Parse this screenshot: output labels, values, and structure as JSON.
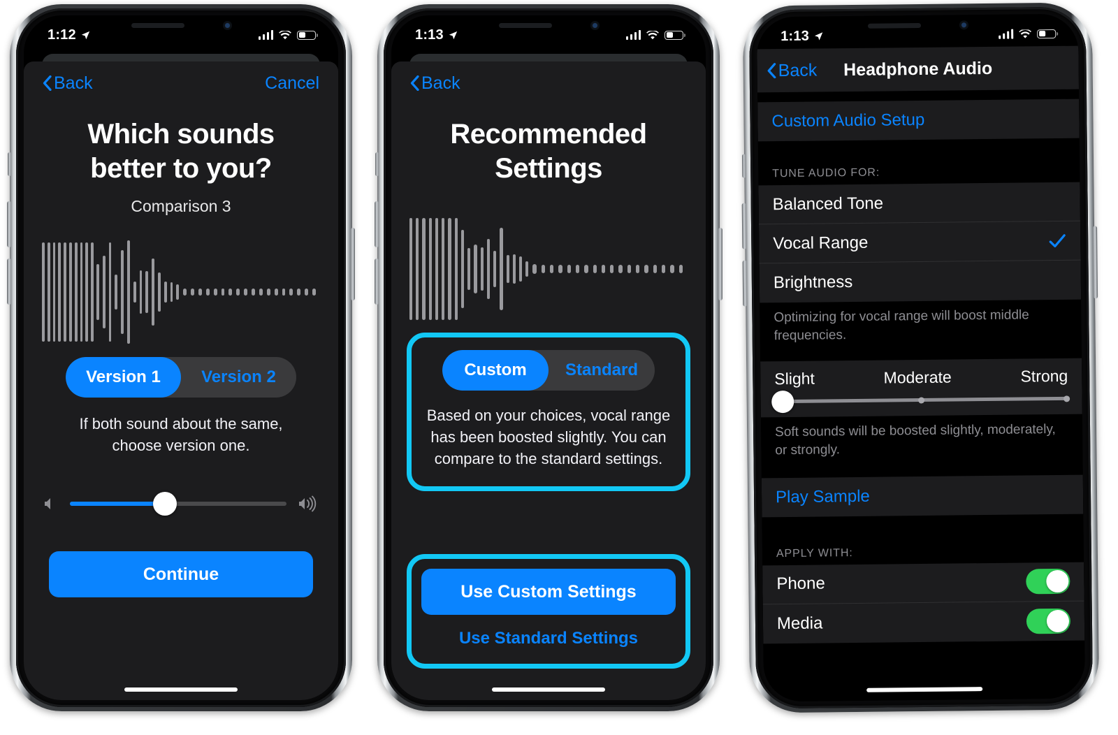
{
  "phone1": {
    "status": {
      "time": "1:12",
      "location_icon": "location-arrow-icon",
      "signal_icon": "cellular-bars-icon",
      "wifi_icon": "wifi-icon",
      "battery_icon": "battery-icon"
    },
    "nav": {
      "back": "Back",
      "cancel": "Cancel",
      "back_icon": "chevron-left-icon"
    },
    "title": "Which sounds better to you?",
    "subtitle": "Comparison 3",
    "waveform_name": "audio-waveform",
    "segmented": {
      "selected": "Version 1",
      "unselected": "Version 2"
    },
    "hint": "If both sound about the same, choose version one.",
    "volume": {
      "value_pct": 44,
      "low_icon": "speaker-low-icon",
      "high_icon": "speaker-high-icon"
    },
    "continue_label": "Continue"
  },
  "phone2": {
    "status": {
      "time": "1:13",
      "location_icon": "location-arrow-icon",
      "signal_icon": "cellular-bars-icon",
      "wifi_icon": "wifi-icon",
      "battery_icon": "battery-icon"
    },
    "nav": {
      "back": "Back",
      "back_icon": "chevron-left-icon"
    },
    "title": "Recommended Settings",
    "waveform_name": "audio-waveform",
    "segmented": {
      "selected": "Custom",
      "unselected": "Standard"
    },
    "description": "Based on your choices, vocal range has been boosted slightly. You can compare to the standard settings.",
    "primary_label": "Use Custom Settings",
    "secondary_label": "Use Standard Settings",
    "highlight_color": "#12c8f5"
  },
  "phone3": {
    "status": {
      "time": "1:13",
      "location_icon": "location-arrow-icon",
      "signal_icon": "cellular-bars-icon",
      "wifi_icon": "wifi-icon",
      "battery_icon": "battery-icon"
    },
    "nav": {
      "back": "Back",
      "title": "Headphone Audio",
      "back_icon": "chevron-left-icon"
    },
    "custom_audio_setup": "Custom Audio Setup",
    "tune_header": "TUNE AUDIO FOR:",
    "tune_options": [
      {
        "label": "Balanced Tone",
        "checked": false
      },
      {
        "label": "Vocal Range",
        "checked": true
      },
      {
        "label": "Brightness",
        "checked": false
      }
    ],
    "tune_footnote": "Optimizing for vocal range will boost middle frequencies.",
    "strength": {
      "left": "Slight",
      "middle": "Moderate",
      "right": "Strong",
      "value_pct": 0
    },
    "strength_footnote": "Soft sounds will be boosted slightly, moderately, or strongly.",
    "play_sample": "Play Sample",
    "apply_header": "APPLY WITH:",
    "apply_options": [
      {
        "label": "Phone",
        "on": true
      },
      {
        "label": "Media",
        "on": true
      }
    ],
    "toggle_on_color": "#30d158",
    "accent_color": "#0a84ff"
  }
}
